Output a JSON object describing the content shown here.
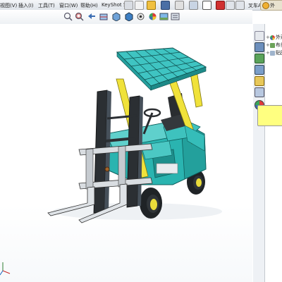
{
  "menu": {
    "items": [
      {
        "label": "视图(V)"
      },
      {
        "label": "插入(I)"
      },
      {
        "label": "工具(T)"
      },
      {
        "label": "窗口(W)"
      },
      {
        "label": "帮助(H)"
      },
      {
        "label": "KeyShot 5"
      }
    ],
    "document_title": "叉车A",
    "right_badge": "外"
  },
  "panel": {
    "tree": [
      {
        "label": "外观("
      },
      {
        "label": "布景"
      },
      {
        "label": "贴图"
      }
    ]
  },
  "colors": {
    "model_teal": "#2ab4b0",
    "mast_yellow": "#f0e23a",
    "frame_dark": "#2b2f33",
    "note_yellow": "#ffff80"
  }
}
